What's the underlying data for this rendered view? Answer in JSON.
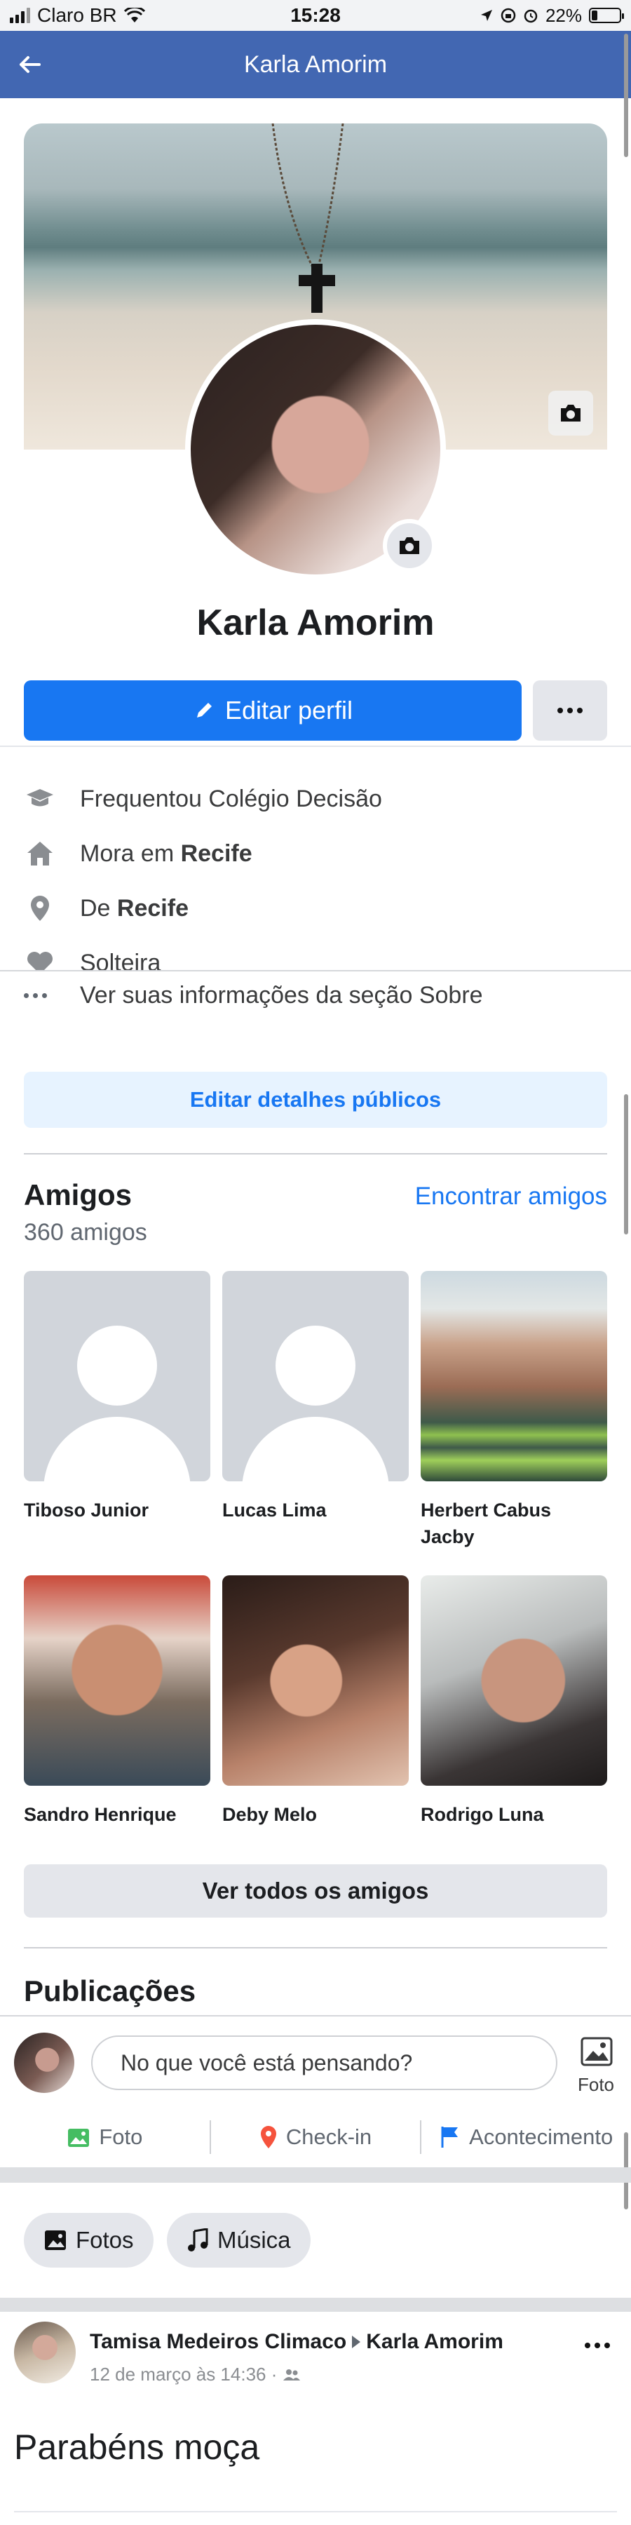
{
  "status_bar": {
    "carrier": "Claro BR",
    "time": "15:28",
    "battery": "22%",
    "battery_level": 0.22
  },
  "header": {
    "title": "Karla Amorim"
  },
  "profile": {
    "name": "Karla Amorim",
    "edit_label": "Editar perfil"
  },
  "info": {
    "items": [
      {
        "icon": "graduation-cap-icon",
        "text": "Frequentou Colégio Decisão",
        "bold": ""
      },
      {
        "icon": "home-icon",
        "text": "Mora em ",
        "bold": "Recife"
      },
      {
        "icon": "location-pin-icon",
        "text": "De ",
        "bold": "Recife"
      },
      {
        "icon": "heart-icon",
        "text": "Solteira",
        "bold": ""
      }
    ],
    "about_label": "Ver suas informações da seção Sobre",
    "public_details_label": "Editar detalhes públicos"
  },
  "friends": {
    "title": "Amigos",
    "count": "360 amigos",
    "find_label": "Encontrar amigos",
    "list": [
      {
        "name": "Tiboso Junior",
        "photo": "placeholder"
      },
      {
        "name": "Lucas Lima",
        "photo": "placeholder"
      },
      {
        "name": "Herbert Cabus Jacby",
        "photo": "photo"
      },
      {
        "name": "Sandro Henrique",
        "photo": "photo"
      },
      {
        "name": "Deby Melo",
        "photo": "photo"
      },
      {
        "name": "Rodrigo Luna",
        "photo": "photo"
      }
    ],
    "see_all_label": "Ver todos os amigos"
  },
  "posts": {
    "title": "Publicações",
    "composer_placeholder": "No que você está pensando?",
    "photo_side_label": "Foto",
    "actions": [
      {
        "icon": "photo-icon",
        "label": "Foto",
        "color": "#45bd62"
      },
      {
        "icon": "checkin-pin-icon",
        "label": "Check-in",
        "color": "#f5533d"
      },
      {
        "icon": "flag-icon",
        "label": "Acontecimento",
        "color": "#1877f2"
      }
    ],
    "chips": [
      {
        "icon": "photos-icon",
        "label": "Fotos"
      },
      {
        "icon": "music-note-icon",
        "label": "Música"
      }
    ]
  },
  "post": {
    "author": "Tamisa Medeiros Climaco",
    "target": "Karla Amorim",
    "date": "12 de março às 14:36 ·",
    "text": "Parabéns moça"
  },
  "colors": {
    "header_blue": "#4267b2",
    "primary_blue": "#1877f2",
    "light_blue_bg": "#e7f3ff",
    "grey_button": "#e4e6eb"
  }
}
